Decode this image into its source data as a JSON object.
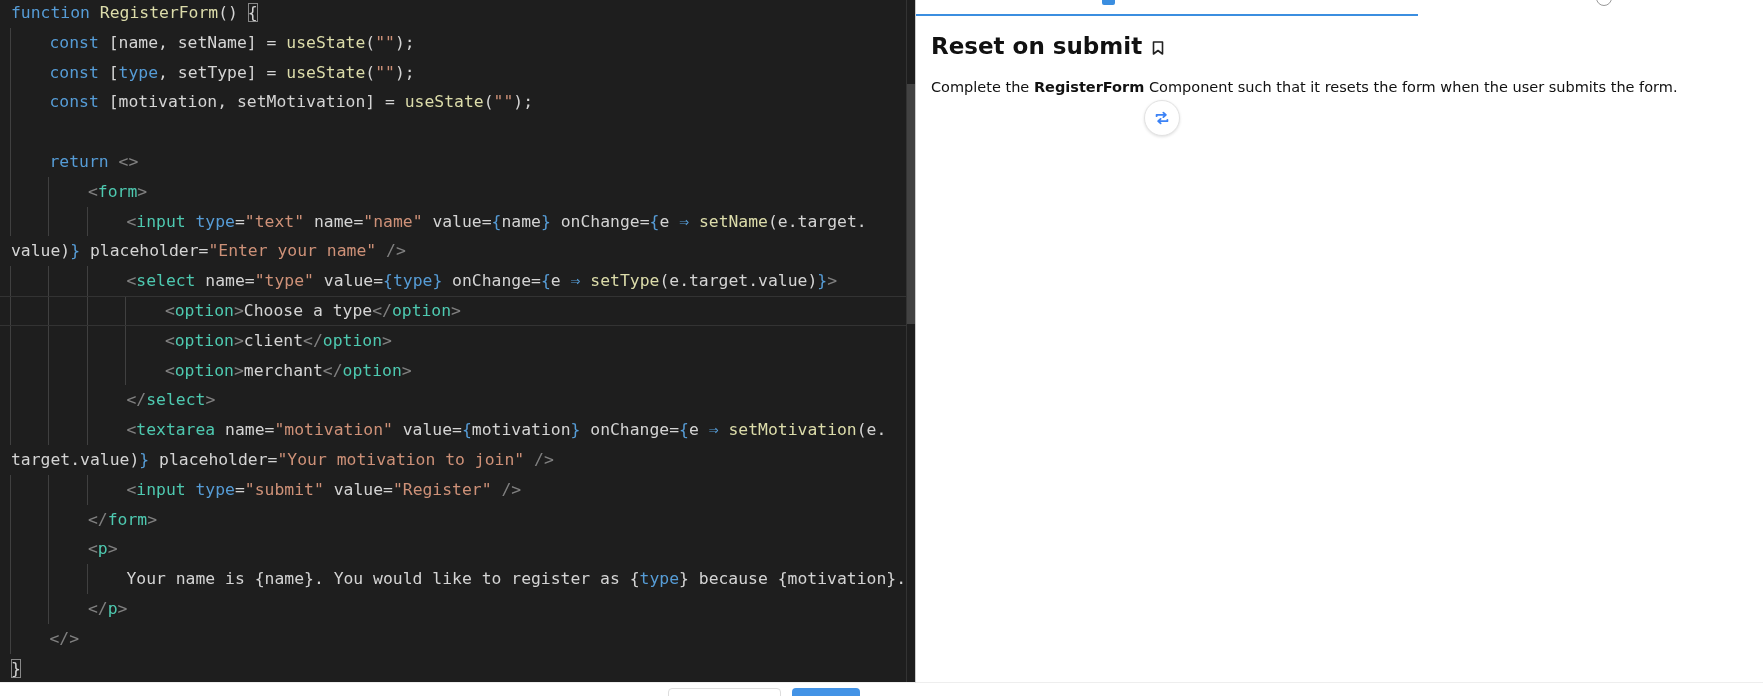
{
  "editor": {
    "lines": [
      {
        "kind": "code",
        "current": false,
        "tokens": [
          {
            "kind": "kw",
            "text": "function "
          },
          {
            "kind": "fn",
            "text": "RegisterForm"
          },
          {
            "kind": "plain",
            "text": "() "
          },
          {
            "kind": "match",
            "text": "{"
          }
        ],
        "children": [
          {
            "kind": "code",
            "current": false,
            "tokens": [
              {
                "kind": "kw",
                "text": "const"
              },
              {
                "kind": "plain",
                "text": " [name, setName] = "
              },
              {
                "kind": "fn",
                "text": "useState"
              },
              {
                "kind": "plain",
                "text": "("
              },
              {
                "kind": "str",
                "text": "\"\""
              },
              {
                "kind": "plain",
                "text": ");"
              }
            ]
          },
          {
            "kind": "code",
            "current": false,
            "tokens": [
              {
                "kind": "kw",
                "text": "const"
              },
              {
                "kind": "plain",
                "text": " ["
              },
              {
                "kind": "kw",
                "text": "type"
              },
              {
                "kind": "plain",
                "text": ", setType] = "
              },
              {
                "kind": "fn",
                "text": "useState"
              },
              {
                "kind": "plain",
                "text": "("
              },
              {
                "kind": "str",
                "text": "\"\""
              },
              {
                "kind": "plain",
                "text": ");"
              }
            ]
          },
          {
            "kind": "code",
            "current": false,
            "tokens": [
              {
                "kind": "kw",
                "text": "const"
              },
              {
                "kind": "plain",
                "text": " [motivation, setMotivation] = "
              },
              {
                "kind": "fn",
                "text": "useState"
              },
              {
                "kind": "plain",
                "text": "("
              },
              {
                "kind": "str",
                "text": "\"\""
              },
              {
                "kind": "plain",
                "text": ");"
              }
            ]
          },
          {
            "kind": "blank",
            "current": false
          },
          {
            "kind": "code",
            "current": false,
            "tokens": [
              {
                "kind": "kw",
                "text": "return "
              },
              {
                "kind": "punct",
                "text": "<>"
              }
            ],
            "children": [
              {
                "kind": "code",
                "current": false,
                "tokens": [
                  {
                    "kind": "punct",
                    "text": "<"
                  },
                  {
                    "kind": "tag",
                    "text": "form"
                  },
                  {
                    "kind": "punct",
                    "text": ">"
                  }
                ],
                "children": [
                  {
                    "kind": "code",
                    "current": false,
                    "tokens": [
                      {
                        "kind": "punct",
                        "text": "<"
                      },
                      {
                        "kind": "tag",
                        "text": "input "
                      },
                      {
                        "kind": "kw",
                        "text": "type"
                      },
                      {
                        "kind": "plain",
                        "text": "="
                      },
                      {
                        "kind": "str",
                        "text": "\"text\""
                      },
                      {
                        "kind": "plain",
                        "text": " name="
                      },
                      {
                        "kind": "str",
                        "text": "\"name\""
                      },
                      {
                        "kind": "plain",
                        "text": " value="
                      },
                      {
                        "kind": "brace",
                        "text": "{"
                      },
                      {
                        "kind": "plain",
                        "text": "name"
                      },
                      {
                        "kind": "brace",
                        "text": "}"
                      },
                      {
                        "kind": "plain",
                        "text": " onChange="
                      },
                      {
                        "kind": "brace",
                        "text": "{"
                      },
                      {
                        "kind": "plain",
                        "text": "e "
                      },
                      {
                        "kind": "kw",
                        "text": "⇒ "
                      },
                      {
                        "kind": "fn",
                        "text": "setName"
                      },
                      {
                        "kind": "plain",
                        "text": "(e.target."
                      }
                    ]
                  },
                  {
                    "kind": "wrap",
                    "current": false,
                    "tokens": [
                      {
                        "kind": "plain",
                        "text": "value)"
                      },
                      {
                        "kind": "brace",
                        "text": "}"
                      },
                      {
                        "kind": "plain",
                        "text": " placeholder="
                      },
                      {
                        "kind": "str",
                        "text": "\"Enter your name\" "
                      },
                      {
                        "kind": "punct",
                        "text": "/>"
                      }
                    ]
                  },
                  {
                    "kind": "code",
                    "current": false,
                    "tokens": [
                      {
                        "kind": "punct",
                        "text": "<"
                      },
                      {
                        "kind": "tag",
                        "text": "select"
                      },
                      {
                        "kind": "plain",
                        "text": " name="
                      },
                      {
                        "kind": "str",
                        "text": "\"type\""
                      },
                      {
                        "kind": "plain",
                        "text": " value="
                      },
                      {
                        "kind": "brace",
                        "text": "{"
                      },
                      {
                        "kind": "kw",
                        "text": "type"
                      },
                      {
                        "kind": "brace",
                        "text": "}"
                      },
                      {
                        "kind": "plain",
                        "text": " onChange="
                      },
                      {
                        "kind": "brace",
                        "text": "{"
                      },
                      {
                        "kind": "plain",
                        "text": "e "
                      },
                      {
                        "kind": "kw",
                        "text": "⇒ "
                      },
                      {
                        "kind": "fn",
                        "text": "setType"
                      },
                      {
                        "kind": "plain",
                        "text": "(e.target.value)"
                      },
                      {
                        "kind": "brace",
                        "text": "}"
                      },
                      {
                        "kind": "punct",
                        "text": ">"
                      }
                    ],
                    "children": [
                      {
                        "kind": "code",
                        "current": true,
                        "tokens": [
                          {
                            "kind": "punct",
                            "text": "<"
                          },
                          {
                            "kind": "tag",
                            "text": "option"
                          },
                          {
                            "kind": "punct",
                            "text": ">"
                          },
                          {
                            "kind": "plain",
                            "text": "Choose a type"
                          },
                          {
                            "kind": "punct",
                            "text": "</"
                          },
                          {
                            "kind": "tag",
                            "text": "option"
                          },
                          {
                            "kind": "punct",
                            "text": ">"
                          }
                        ]
                      },
                      {
                        "kind": "code",
                        "current": false,
                        "tokens": [
                          {
                            "kind": "punct",
                            "text": "<"
                          },
                          {
                            "kind": "tag",
                            "text": "option"
                          },
                          {
                            "kind": "punct",
                            "text": ">"
                          },
                          {
                            "kind": "plain",
                            "text": "client"
                          },
                          {
                            "kind": "punct",
                            "text": "</"
                          },
                          {
                            "kind": "tag",
                            "text": "option"
                          },
                          {
                            "kind": "punct",
                            "text": ">"
                          }
                        ]
                      },
                      {
                        "kind": "code",
                        "current": false,
                        "tokens": [
                          {
                            "kind": "punct",
                            "text": "<"
                          },
                          {
                            "kind": "tag",
                            "text": "option"
                          },
                          {
                            "kind": "punct",
                            "text": ">"
                          },
                          {
                            "kind": "plain",
                            "text": "merchant"
                          },
                          {
                            "kind": "punct",
                            "text": "</"
                          },
                          {
                            "kind": "tag",
                            "text": "option"
                          },
                          {
                            "kind": "punct",
                            "text": ">"
                          }
                        ]
                      }
                    ]
                  },
                  {
                    "kind": "code",
                    "current": false,
                    "tokens": [
                      {
                        "kind": "punct",
                        "text": "</"
                      },
                      {
                        "kind": "tag",
                        "text": "select"
                      },
                      {
                        "kind": "punct",
                        "text": ">"
                      }
                    ]
                  },
                  {
                    "kind": "code",
                    "current": false,
                    "tokens": [
                      {
                        "kind": "punct",
                        "text": "<"
                      },
                      {
                        "kind": "tag",
                        "text": "textarea"
                      },
                      {
                        "kind": "plain",
                        "text": " name="
                      },
                      {
                        "kind": "str",
                        "text": "\"motivation\""
                      },
                      {
                        "kind": "plain",
                        "text": " value="
                      },
                      {
                        "kind": "brace",
                        "text": "{"
                      },
                      {
                        "kind": "plain",
                        "text": "motivation"
                      },
                      {
                        "kind": "brace",
                        "text": "}"
                      },
                      {
                        "kind": "plain",
                        "text": " onChange="
                      },
                      {
                        "kind": "brace",
                        "text": "{"
                      },
                      {
                        "kind": "plain",
                        "text": "e "
                      },
                      {
                        "kind": "kw",
                        "text": "⇒ "
                      },
                      {
                        "kind": "fn",
                        "text": "setMotivation"
                      },
                      {
                        "kind": "plain",
                        "text": "(e."
                      }
                    ]
                  },
                  {
                    "kind": "wrap",
                    "current": false,
                    "tokens": [
                      {
                        "kind": "plain",
                        "text": "target.value)"
                      },
                      {
                        "kind": "brace",
                        "text": "}"
                      },
                      {
                        "kind": "plain",
                        "text": " placeholder="
                      },
                      {
                        "kind": "str",
                        "text": "\"Your motivation to join\" "
                      },
                      {
                        "kind": "punct",
                        "text": "/>"
                      }
                    ]
                  },
                  {
                    "kind": "code",
                    "current": false,
                    "tokens": [
                      {
                        "kind": "punct",
                        "text": "<"
                      },
                      {
                        "kind": "tag",
                        "text": "input "
                      },
                      {
                        "kind": "kw",
                        "text": "type"
                      },
                      {
                        "kind": "plain",
                        "text": "="
                      },
                      {
                        "kind": "str",
                        "text": "\"submit\""
                      },
                      {
                        "kind": "plain",
                        "text": " value="
                      },
                      {
                        "kind": "str",
                        "text": "\"Register\" "
                      },
                      {
                        "kind": "punct",
                        "text": "/>"
                      }
                    ]
                  }
                ]
              },
              {
                "kind": "code",
                "current": false,
                "tokens": [
                  {
                    "kind": "punct",
                    "text": "</"
                  },
                  {
                    "kind": "tag",
                    "text": "form"
                  },
                  {
                    "kind": "punct",
                    "text": ">"
                  }
                ]
              },
              {
                "kind": "code",
                "current": false,
                "tokens": [
                  {
                    "kind": "punct",
                    "text": "<"
                  },
                  {
                    "kind": "tag",
                    "text": "p"
                  },
                  {
                    "kind": "punct",
                    "text": ">"
                  }
                ],
                "children": [
                  {
                    "kind": "code",
                    "current": false,
                    "tokens": [
                      {
                        "kind": "plain",
                        "text": "Your name is {name}. You would like to register as {"
                      },
                      {
                        "kind": "kw",
                        "text": "type"
                      },
                      {
                        "kind": "plain",
                        "text": "} because {motivation}."
                      }
                    ]
                  }
                ]
              },
              {
                "kind": "code",
                "current": false,
                "tokens": [
                  {
                    "kind": "punct",
                    "text": "</"
                  },
                  {
                    "kind": "tag",
                    "text": "p"
                  },
                  {
                    "kind": "punct",
                    "text": ">"
                  }
                ]
              }
            ]
          },
          {
            "kind": "code",
            "current": false,
            "tokens": [
              {
                "kind": "punct",
                "text": "</>"
              }
            ]
          }
        ]
      },
      {
        "kind": "code",
        "current": false,
        "tokens": [
          {
            "kind": "match",
            "text": "}"
          }
        ]
      }
    ]
  },
  "problem": {
    "title": "Reset on submit",
    "description": "Complete the **RegisterForm** Component such that it resets the form when the user submits the form."
  }
}
